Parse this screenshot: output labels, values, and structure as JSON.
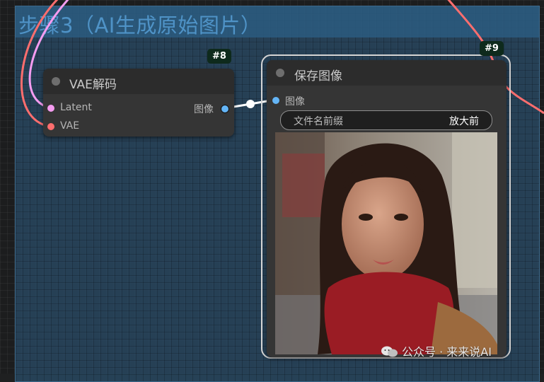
{
  "group": {
    "title": "步骤3（AI生成原始图片）"
  },
  "vae_node": {
    "badge": "#8",
    "title": "VAE解码",
    "inputs": [
      {
        "label": "Latent",
        "color": "#f59cf0"
      },
      {
        "label": "VAE",
        "color": "#ff6e6e"
      }
    ],
    "outputs": [
      {
        "label": "图像",
        "color": "#64b5f6"
      }
    ]
  },
  "save_node": {
    "badge": "#9",
    "title": "保存图像",
    "inputs": [
      {
        "label": "图像",
        "color": "#64b5f6"
      }
    ],
    "widget": {
      "label": "文件名前缀",
      "value": "放大前"
    },
    "image_icon": "photo-portrait-woman-red-scarf"
  },
  "watermark": {
    "text": "公众号 · 来来说AI",
    "icon": "wechat-icon"
  },
  "colors": {
    "link_pink": "#f59cf0",
    "link_red": "#ff6e6e",
    "link_white": "#ffffff",
    "node_bg": "#353535",
    "group_title": "#4f93c7"
  }
}
